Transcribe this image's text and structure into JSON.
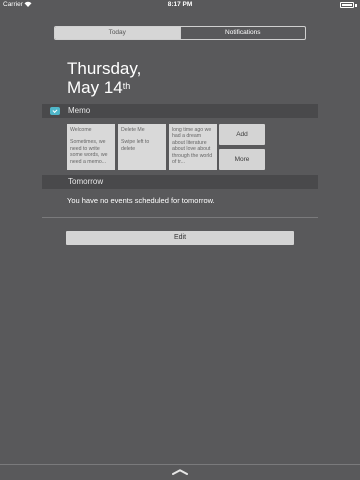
{
  "status_bar": {
    "carrier": "Carrier",
    "time": "8:17 PM",
    "wifi_icon": "wifi-icon",
    "battery_icon": "battery-icon",
    "battery_level": 1.0
  },
  "segments": {
    "today": "Today",
    "notifications": "Notifications",
    "selected": "today"
  },
  "date": {
    "weekday": "Thursday,",
    "month_day": "May 14",
    "ordinal": "th"
  },
  "memo": {
    "title": "Memo",
    "icon": "memo-app-icon",
    "icon_color": "#4fb6c9",
    "notes": [
      {
        "title": "Welcome",
        "body": "Sometimes, we need to write some words, we need a memo..."
      },
      {
        "title": "Delete Me",
        "body": "Swipe left to delete"
      },
      {
        "title": "",
        "body": "long time ago we had a dream about literature about love about through the world of tr..."
      }
    ],
    "add_label": "Add",
    "more_label": "More"
  },
  "tomorrow": {
    "title": "Tomorrow",
    "message": "You have no events scheduled for tomorrow."
  },
  "edit_label": "Edit",
  "grabber_icon": "chevron-handle-icon"
}
